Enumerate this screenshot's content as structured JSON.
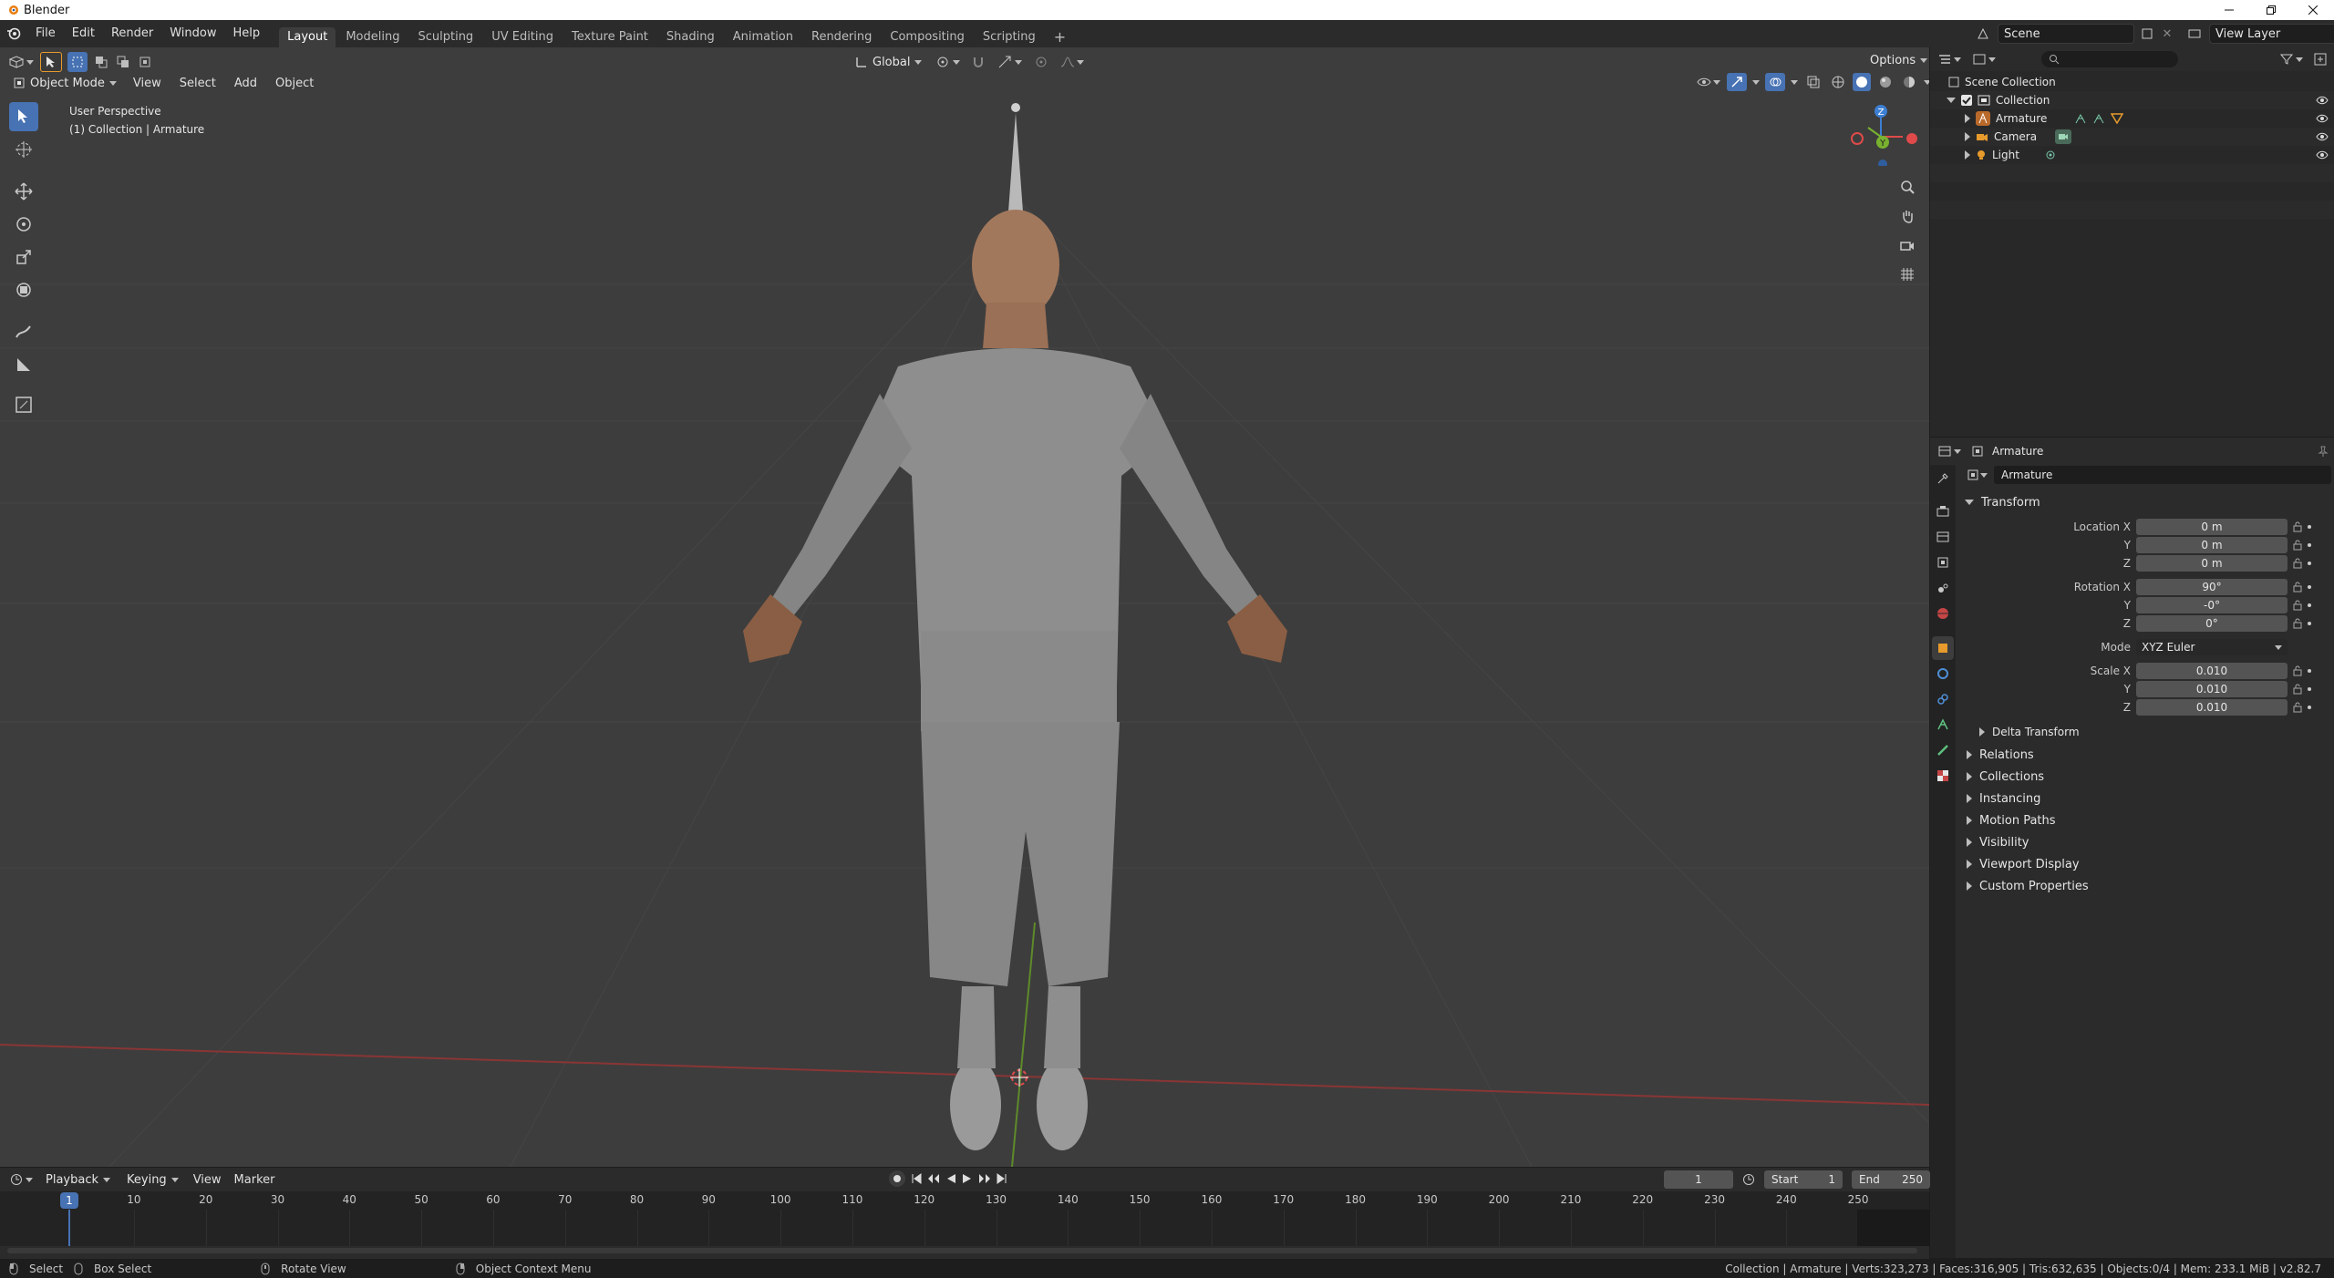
{
  "window": {
    "title": "Blender"
  },
  "menu": [
    "File",
    "Edit",
    "Render",
    "Window",
    "Help"
  ],
  "workspaces": [
    "Layout",
    "Modeling",
    "Sculpting",
    "UV Editing",
    "Texture Paint",
    "Shading",
    "Animation",
    "Rendering",
    "Compositing",
    "Scripting"
  ],
  "active_workspace": "Layout",
  "scene": {
    "name": "Scene",
    "view_layer": "View Layer"
  },
  "viewport": {
    "mode": "Object Mode",
    "menus": [
      "View",
      "Select",
      "Add",
      "Object"
    ],
    "orientation": "Global",
    "options_label": "Options",
    "overlay_title": "User Perspective",
    "overlay_sub": "(1) Collection | Armature",
    "gizmo": {
      "x": "X",
      "y": "Y",
      "z": "Z"
    }
  },
  "outliner": {
    "root": "Scene Collection",
    "collection": "Collection",
    "items": [
      "Armature",
      "Camera",
      "Light"
    ],
    "search_placeholder": ""
  },
  "properties": {
    "breadcrumb": "Armature",
    "object_name": "Armature",
    "transform_label": "Transform",
    "location_label": "Location X",
    "location": [
      "0 m",
      "0 m",
      "0 m"
    ],
    "rotation_label": "Rotation X",
    "rotation": [
      "90°",
      "-0°",
      "0°"
    ],
    "mode_label": "Mode",
    "mode_value": "XYZ Euler",
    "scale_label": "Scale X",
    "scale": [
      "0.010",
      "0.010",
      "0.010"
    ],
    "axis_y": "Y",
    "axis_z": "Z",
    "delta": "Delta Transform",
    "panels": [
      "Relations",
      "Collections",
      "Instancing",
      "Motion Paths",
      "Visibility",
      "Viewport Display",
      "Custom Properties"
    ]
  },
  "timeline": {
    "menus": [
      "Playback",
      "Keying",
      "View",
      "Marker"
    ],
    "current_frame": "1",
    "start_label": "Start",
    "start": "1",
    "end_label": "End",
    "end": "250",
    "ticks": [
      "10",
      "20",
      "30",
      "40",
      "50",
      "60",
      "70",
      "80",
      "90",
      "100",
      "110",
      "120",
      "130",
      "140",
      "150",
      "160",
      "170",
      "180",
      "190",
      "200",
      "210",
      "220",
      "230",
      "240",
      "250"
    ],
    "cursor_frame": "1"
  },
  "statusbar": {
    "select": "Select",
    "box_select": "Box Select",
    "rotate_view": "Rotate View",
    "context_menu": "Object Context Menu",
    "stats": "Collection | Armature | Verts:323,273 | Faces:316,905 | Tris:632,635 | Objects:0/4 | Mem: 233.1 MiB | v2.82.7"
  },
  "colors": {
    "accent": "#4772b3",
    "x_axis": "#e04a4a",
    "y_axis": "#78b22f",
    "z_axis": "#3d7fd3",
    "orange": "#e79b2c"
  }
}
